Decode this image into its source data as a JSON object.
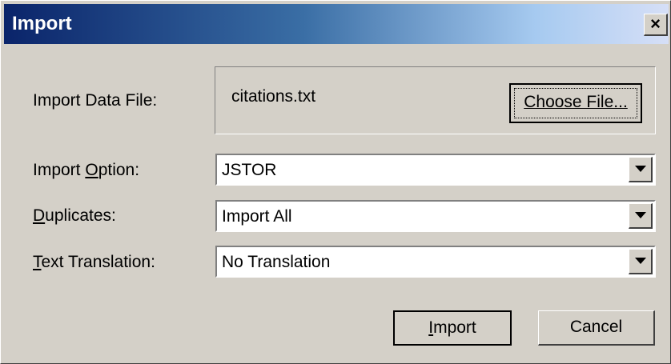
{
  "window": {
    "title": "Import",
    "close_label": "×"
  },
  "import_file": {
    "label": "Import Data File:",
    "file_name": "citations.txt",
    "choose_button": "Choose File..."
  },
  "import_option": {
    "label_pre": "Import ",
    "label_key": "O",
    "label_post": "ption:",
    "value": "JSTOR"
  },
  "duplicates": {
    "label_pre": "",
    "label_key": "D",
    "label_post": "uplicates:",
    "value": "Import All"
  },
  "text_translation": {
    "label_pre": "",
    "label_key": "T",
    "label_post": "ext Translation:",
    "value": "No Translation"
  },
  "buttons": {
    "import_key": "I",
    "import_rest": "mport",
    "cancel": "Cancel"
  },
  "icons": {
    "dropdown": "chevron-down-icon",
    "close": "close-icon"
  }
}
